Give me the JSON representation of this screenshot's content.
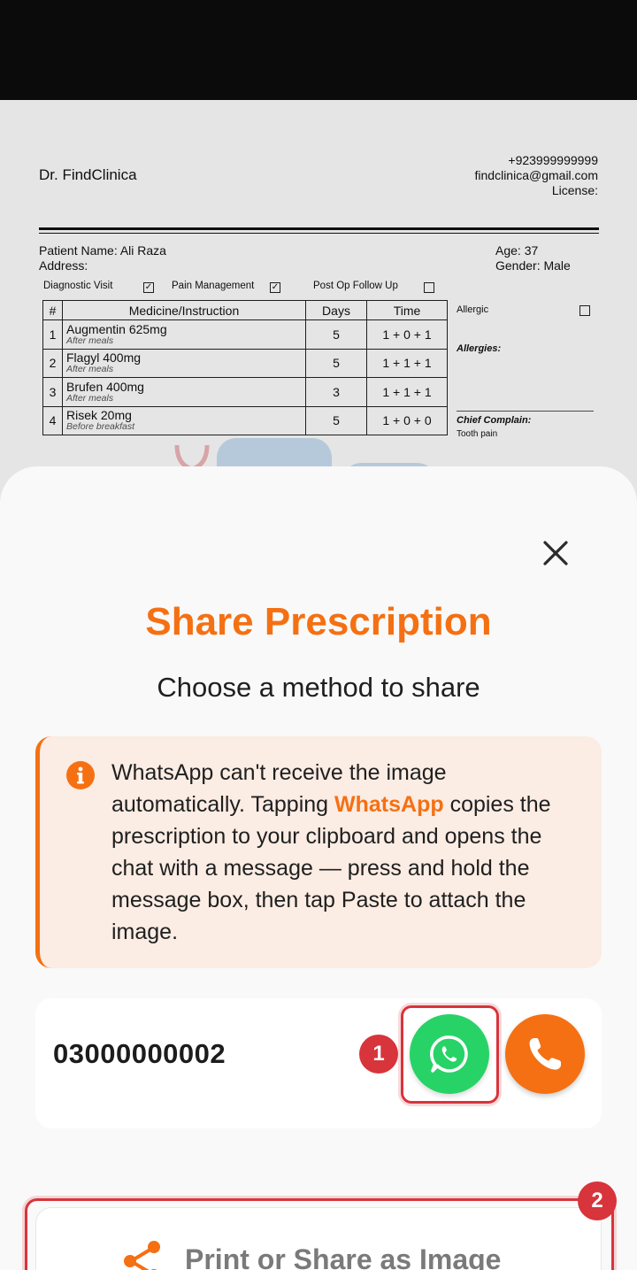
{
  "prescription": {
    "doctor": "Dr. FindClinica",
    "phone": "+923999999999",
    "email": "findclinica@gmail.com",
    "license": "License:",
    "patient_name": "Patient Name: Ali Raza",
    "address": "Address:",
    "age": "Age: 37",
    "gender": "Gender: Male",
    "visit_types": [
      {
        "label": "Diagnostic Visit",
        "checked": true
      },
      {
        "label": "Pain Management",
        "checked": true
      },
      {
        "label": "Post Op Follow Up",
        "checked": false
      }
    ],
    "table_headers": [
      "#",
      "Medicine/Instruction",
      "Days",
      "Time"
    ],
    "medicines": [
      {
        "no": "1",
        "name": "Augmentin 625mg",
        "note": "After meals",
        "days": "5",
        "time": "1 + 0 + 1"
      },
      {
        "no": "2",
        "name": "Flagyl 400mg",
        "note": "After meals",
        "days": "5",
        "time": "1 + 1 + 1"
      },
      {
        "no": "3",
        "name": "Brufen 400mg",
        "note": "After meals",
        "days": "3",
        "time": "1 + 1 + 1"
      },
      {
        "no": "4",
        "name": "Risek 20mg",
        "note": "Before breakfast",
        "days": "5",
        "time": "1 + 0 + 0"
      }
    ],
    "allergic_label": "Allergic",
    "allergies_label": "Allergies:",
    "chief_complain_label": "Chief Complain:",
    "chief_complain_value": "Tooth pain"
  },
  "share_sheet": {
    "title": "Share Prescription",
    "subtitle": "Choose a method to share",
    "notice_before": "WhatsApp can't receive the image automatically. Tapping ",
    "notice_highlight": "WhatsApp",
    "notice_after": " copies the prescription to your clipboard and opens the chat with a message — press and hold the message box, then tap Paste to attach the image.",
    "phone_number": "03000000002",
    "print_share_label": "Print or Share as Image",
    "badge_1": "1",
    "badge_2": "2",
    "colors": {
      "accent": "#f57012",
      "whatsapp": "#27d366",
      "highlight": "#d8343b",
      "notice_bg": "#fbece4"
    },
    "icons": [
      "close-icon",
      "info-icon",
      "whatsapp-icon",
      "phone-icon",
      "share-icon"
    ]
  }
}
